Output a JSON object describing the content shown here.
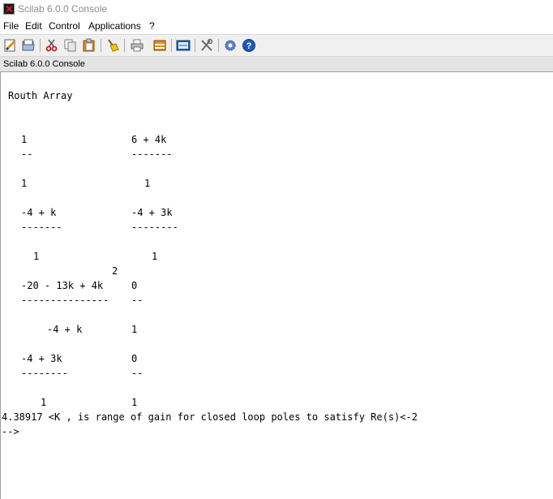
{
  "window": {
    "title": "Scilab 6.0.0 Console"
  },
  "menu": {
    "file": "File",
    "edit": "Edit",
    "control": "Control",
    "applications": "Applications",
    "help": "?"
  },
  "toolbar": {
    "icons": [
      "new-script-icon",
      "open-folder-icon",
      "cut-icon",
      "copy-icon",
      "paste-icon",
      "clear-console-icon",
      "print-icon",
      "variable-browser-icon",
      "sciNotes-icon",
      "module-manager-icon",
      "preferences-icon",
      "help-icon"
    ]
  },
  "console": {
    "tab_title": "Scilab 6.0.0 Console",
    "heading": "Routh Array",
    "rows": [
      {
        "left": "1",
        "right": "6 + 4k"
      },
      {
        "left": "--",
        "right": "-------"
      },
      {
        "left": "1",
        "right": "1"
      },
      {
        "left": "-4 + k",
        "right": "-4 + 3k"
      },
      {
        "left": "-------",
        "right": "--------"
      },
      {
        "left": "1",
        "right": "1"
      },
      {
        "exponent": "2"
      },
      {
        "left": "-20 - 13k + 4k",
        "right": "0"
      },
      {
        "left": "---------------",
        "right": "--"
      },
      {
        "left": "-4 + k",
        "right": "1"
      },
      {
        "left": "-4 + 3k",
        "right": "0"
      },
      {
        "left": "--------",
        "right": "--"
      },
      {
        "left": "1",
        "right": "1"
      }
    ],
    "result_line": "4.38917 <K , is range of gain for closed loop poles to satisfy Re(s)<-2",
    "prompt": "-->"
  },
  "colors": {
    "toolbar_bg": "#f0f0f0",
    "console_header_bg": "#e4e4e4",
    "title_text": "#8c8c8c",
    "help_icon_blue": "#1e5bb8",
    "paste_icon_orange": "#e08a1e"
  }
}
